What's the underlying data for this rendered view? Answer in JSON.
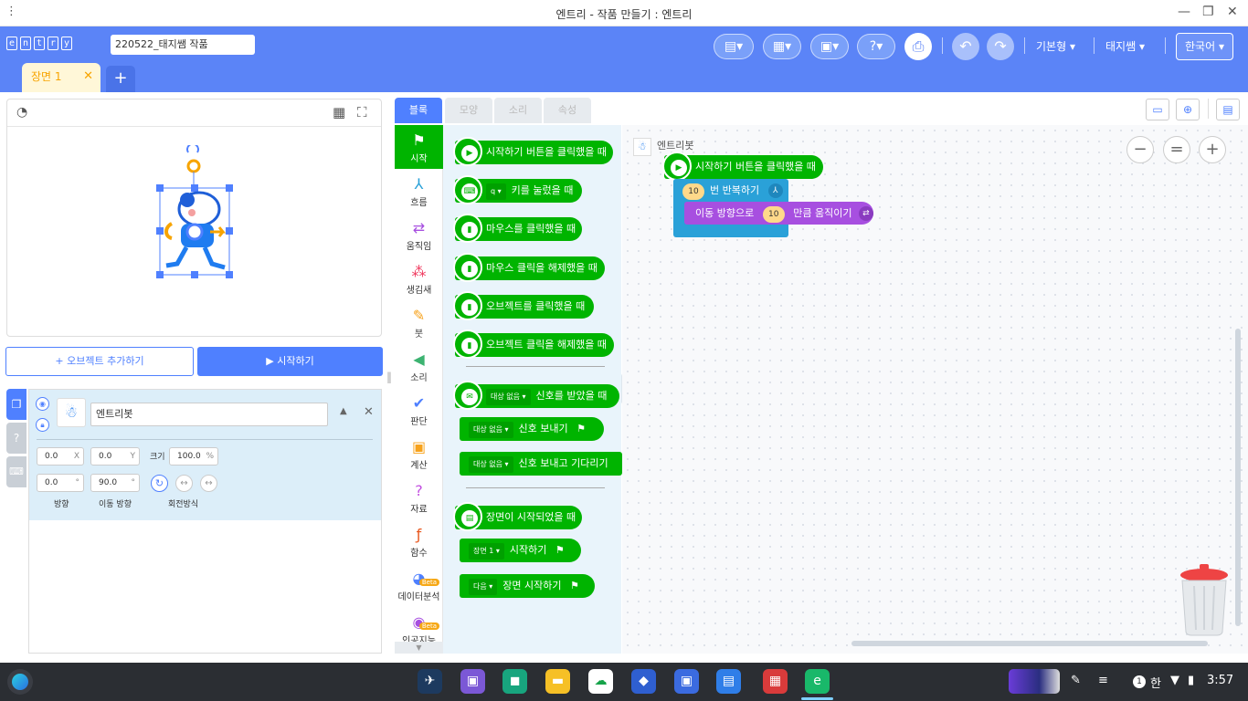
{
  "window": {
    "title": "엔트리 - 작품 만들기 : 엔트리"
  },
  "header": {
    "logo_letters": [
      "e",
      "n",
      "t",
      "r",
      "y"
    ],
    "project_name": "220522_태지쌤 작품",
    "mode_label": "기본형",
    "user_label": "태지쌤",
    "language_label": "한국어"
  },
  "scene": {
    "tab_label": "장면 1"
  },
  "stage": {
    "add_object_label": "+ 오브젝트 추가하기",
    "start_label": "▶ 시작하기"
  },
  "object": {
    "name": "엔트리봇",
    "x": "0.0",
    "x_unit": "X",
    "y": "0.0",
    "y_unit": "Y",
    "size_label": "크기",
    "size": "100.0",
    "size_unit": "%",
    "direction": "0.0",
    "direction_unit": "°",
    "move_direction": "90.0",
    "move_direction_unit": "°",
    "direction_label": "방향",
    "move_direction_label": "이동 방향",
    "rotation_label": "회전방식"
  },
  "tabs": [
    "블록",
    "모양",
    "소리",
    "속성"
  ],
  "categories": [
    {
      "label": "시작",
      "icon": "flag-icon",
      "color": "#ffffff"
    },
    {
      "label": "흐름",
      "icon": "flow-icon",
      "color": "#2aa1d8"
    },
    {
      "label": "움직임",
      "icon": "move-icon",
      "color": "#a74fe0"
    },
    {
      "label": "생김새",
      "icon": "looks-icon",
      "color": "#f03a5f"
    },
    {
      "label": "붓",
      "icon": "brush-icon",
      "color": "#f7a21b"
    },
    {
      "label": "소리",
      "icon": "sound-icon",
      "color": "#3cb371"
    },
    {
      "label": "판단",
      "icon": "judge-icon",
      "color": "#4f80ff"
    },
    {
      "label": "계산",
      "icon": "calc-icon",
      "color": "#f7a21b"
    },
    {
      "label": "자료",
      "icon": "data-icon",
      "color": "#c24fe0"
    },
    {
      "label": "함수",
      "icon": "function-icon",
      "color": "#e8571d"
    },
    {
      "label": "데이터분석",
      "icon": "analysis-icon",
      "color": "#4f80ff",
      "badge": "Beta"
    },
    {
      "label": "인공지능",
      "icon": "ai-icon",
      "color": "#a74fe0",
      "badge": "Beta"
    }
  ],
  "palette": {
    "b1": "시작하기 버튼을 클릭했을 때",
    "b2_key": "q",
    "b2": "키를 눌렀을 때",
    "b3": "마우스를 클릭했을 때",
    "b4": "마우스 클릭을 해제했을 때",
    "b5": "오브젝트를 클릭했을 때",
    "b6": "오브젝트 클릭을 해제했을 때",
    "b7_drop": "대상 없음",
    "b7": "신호를 받았을 때",
    "b8_drop": "대상 없음",
    "b8": "신호 보내기",
    "b9_drop": "대상 없음",
    "b9": "신호 보내고 기다리기",
    "b10": "장면이 시작되었을 때",
    "b11_drop": "장면 1",
    "b11": "시작하기",
    "b12_drop": "다음",
    "b12": "장면 시작하기"
  },
  "script": {
    "object_label": "엔트리봇",
    "hat": "시작하기 버튼을 클릭했을 때",
    "repeat_count": "10",
    "repeat_label": "번 반복하기",
    "move_prefix": "이동 방향으로",
    "move_value": "10",
    "move_suffix": "만큼 움직이기"
  },
  "zoom": {
    "out": "−",
    "reset": "=",
    "in": "+"
  },
  "taskbar": {
    "ime": "한",
    "badge": "1",
    "time": "3:57"
  }
}
